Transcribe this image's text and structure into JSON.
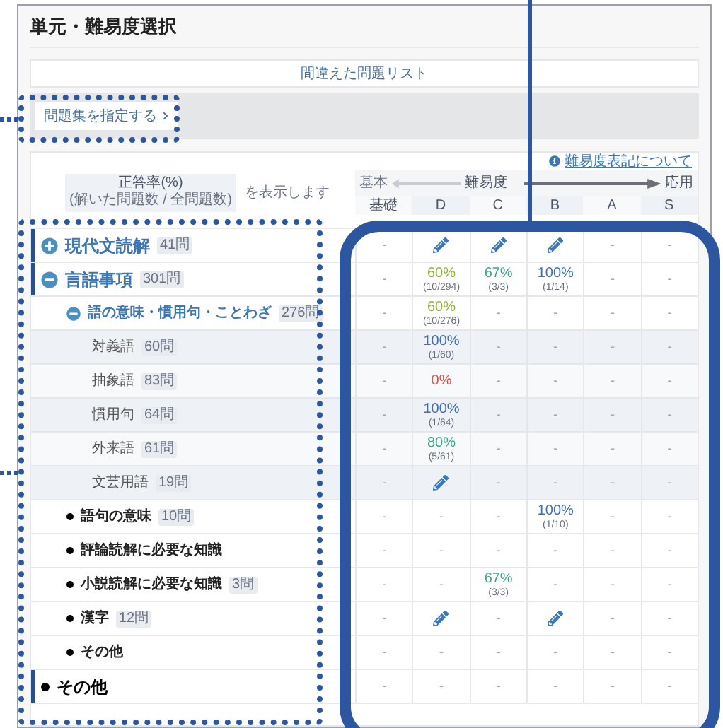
{
  "page": {
    "title": "単元・難易度選択"
  },
  "mistakes_button": "間違えた問題リスト",
  "set_button": "問題集を指定する",
  "difficulty_link": "難易度表記について",
  "legend": {
    "rate": "正答率(%)",
    "counts": "(解いた問題数 / 全問題数)",
    "suffix": "を表示します"
  },
  "scale": {
    "low": "基本",
    "label": "難易度",
    "high": "応用"
  },
  "columns": [
    "基礎",
    "D",
    "C",
    "B",
    "A",
    "S"
  ],
  "units": [
    {
      "name": "現代文読解",
      "count": "41問",
      "expanded": false,
      "cells": [
        {
          "kind": "dash",
          "text": "-"
        },
        {
          "kind": "pencil"
        },
        {
          "kind": "pencil"
        },
        {
          "kind": "pencil"
        },
        {
          "kind": "dash",
          "text": "-"
        },
        {
          "kind": "dash",
          "text": "-"
        }
      ]
    },
    {
      "name": "言語事項",
      "count": "301問",
      "expanded": true,
      "cells": [
        {
          "kind": "dash",
          "text": "-"
        },
        {
          "kind": "rate",
          "rate": "60%",
          "detail": "(10/294)",
          "color": "#8db33b"
        },
        {
          "kind": "rate",
          "rate": "67%",
          "detail": "(3/3)",
          "color": "#3ea68b"
        },
        {
          "kind": "rate",
          "rate": "100%",
          "detail": "(1/14)",
          "color": "#3f6fae"
        },
        {
          "kind": "dash",
          "text": "-"
        },
        {
          "kind": "dash",
          "text": "-"
        }
      ],
      "children": [
        {
          "name": "語の意味・慣用句・ことわざ",
          "count": "276問",
          "expanded": true,
          "cells": [
            {
              "kind": "dash",
              "text": "-"
            },
            {
              "kind": "rate",
              "rate": "60%",
              "detail": "(10/276)",
              "color": "#8db33b"
            },
            {
              "kind": "dash",
              "text": "-"
            },
            {
              "kind": "dash",
              "text": "-"
            },
            {
              "kind": "dash",
              "text": "-"
            },
            {
              "kind": "dash",
              "text": "-"
            }
          ],
          "children": [
            {
              "name": "対義語",
              "count": "60問",
              "cells": [
                {
                  "kind": "dash",
                  "text": "-"
                },
                {
                  "kind": "rate",
                  "rate": "100%",
                  "detail": "(1/60)",
                  "color": "#3f6fae"
                },
                {
                  "kind": "dash",
                  "text": "-"
                },
                {
                  "kind": "dash",
                  "text": "-"
                },
                {
                  "kind": "dash",
                  "text": "-"
                },
                {
                  "kind": "dash",
                  "text": "-"
                }
              ]
            },
            {
              "name": "抽象語",
              "count": "83問",
              "cells": [
                {
                  "kind": "dash",
                  "text": "-"
                },
                {
                  "kind": "rate",
                  "rate": "0%",
                  "color": "#d9534f"
                },
                {
                  "kind": "dash",
                  "text": "-"
                },
                {
                  "kind": "dash",
                  "text": "-"
                },
                {
                  "kind": "dash",
                  "text": "-"
                },
                {
                  "kind": "dash",
                  "text": "-"
                }
              ]
            },
            {
              "name": "慣用句",
              "count": "64問",
              "cells": [
                {
                  "kind": "dash",
                  "text": "-"
                },
                {
                  "kind": "rate",
                  "rate": "100%",
                  "detail": "(1/64)",
                  "color": "#3f6fae"
                },
                {
                  "kind": "dash",
                  "text": "-"
                },
                {
                  "kind": "dash",
                  "text": "-"
                },
                {
                  "kind": "dash",
                  "text": "-"
                },
                {
                  "kind": "dash",
                  "text": "-"
                }
              ]
            },
            {
              "name": "外来語",
              "count": "61問",
              "cells": [
                {
                  "kind": "dash",
                  "text": "-"
                },
                {
                  "kind": "rate",
                  "rate": "80%",
                  "detail": "(5/61)",
                  "color": "#3ea68b"
                },
                {
                  "kind": "dash",
                  "text": "-"
                },
                {
                  "kind": "dash",
                  "text": "-"
                },
                {
                  "kind": "dash",
                  "text": "-"
                },
                {
                  "kind": "dash",
                  "text": "-"
                }
              ]
            },
            {
              "name": "文芸用語",
              "count": "19問",
              "cells": [
                {
                  "kind": "dash",
                  "text": "-"
                },
                {
                  "kind": "pencil"
                },
                {
                  "kind": "dash",
                  "text": "-"
                },
                {
                  "kind": "dash",
                  "text": "-"
                },
                {
                  "kind": "dash",
                  "text": "-"
                },
                {
                  "kind": "dash",
                  "text": "-"
                }
              ]
            }
          ]
        },
        {
          "name": "語句の意味",
          "count": "10問",
          "cells": [
            {
              "kind": "dash",
              "text": "-"
            },
            {
              "kind": "dash",
              "text": "-"
            },
            {
              "kind": "dash",
              "text": "-"
            },
            {
              "kind": "rate",
              "rate": "100%",
              "detail": "(1/10)",
              "color": "#3f6fae"
            },
            {
              "kind": "dash",
              "text": "-"
            },
            {
              "kind": "dash",
              "text": "-"
            }
          ]
        },
        {
          "name": "評論読解に必要な知識",
          "cells": [
            {
              "kind": "dash",
              "text": "-"
            },
            {
              "kind": "dash",
              "text": "-"
            },
            {
              "kind": "dash",
              "text": "-"
            },
            {
              "kind": "dash",
              "text": "-"
            },
            {
              "kind": "dash",
              "text": "-"
            },
            {
              "kind": "dash",
              "text": "-"
            }
          ]
        },
        {
          "name": "小説読解に必要な知識",
          "count": "3問",
          "cells": [
            {
              "kind": "dash",
              "text": "-"
            },
            {
              "kind": "dash",
              "text": "-"
            },
            {
              "kind": "rate",
              "rate": "67%",
              "detail": "(3/3)",
              "color": "#3ea68b"
            },
            {
              "kind": "dash",
              "text": "-"
            },
            {
              "kind": "dash",
              "text": "-"
            },
            {
              "kind": "dash",
              "text": "-"
            }
          ]
        },
        {
          "name": "漢字",
          "count": "12問",
          "cells": [
            {
              "kind": "dash",
              "text": "-"
            },
            {
              "kind": "pencil"
            },
            {
              "kind": "dash",
              "text": "-"
            },
            {
              "kind": "pencil"
            },
            {
              "kind": "dash",
              "text": "-"
            },
            {
              "kind": "dash",
              "text": "-"
            }
          ]
        },
        {
          "name": "その他",
          "cells": [
            {
              "kind": "dash",
              "text": "-"
            },
            {
              "kind": "dash",
              "text": "-"
            },
            {
              "kind": "dash",
              "text": "-"
            },
            {
              "kind": "dash",
              "text": "-"
            },
            {
              "kind": "dash",
              "text": "-"
            },
            {
              "kind": "dash",
              "text": "-"
            }
          ]
        }
      ]
    },
    {
      "name": "その他",
      "cells": [
        {
          "kind": "dash",
          "text": "-"
        },
        {
          "kind": "dash",
          "text": "-"
        },
        {
          "kind": "dash",
          "text": "-"
        },
        {
          "kind": "dash",
          "text": "-"
        },
        {
          "kind": "dash",
          "text": "-"
        },
        {
          "kind": "dash",
          "text": "-"
        }
      ]
    }
  ]
}
